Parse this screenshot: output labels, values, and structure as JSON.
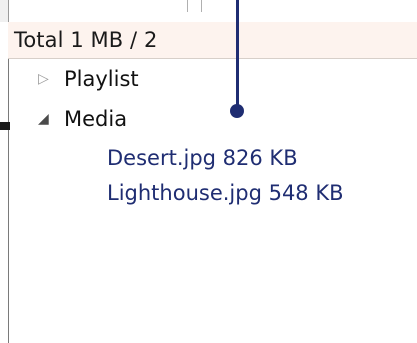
{
  "header": {
    "total_label": "Total 1 MB / 2"
  },
  "tree": {
    "items": [
      {
        "label": "Playlist",
        "state": "collapsed",
        "icon": "triangle-right-icon"
      },
      {
        "label": "Media",
        "state": "expanded",
        "icon": "triangle-down-icon",
        "children": [
          {
            "label": "Desert.jpg 826 KB"
          },
          {
            "label": "Lighthouse.jpg 548 KB"
          }
        ]
      }
    ]
  },
  "colors": {
    "header_bg": "#fdf3ee",
    "child_text": "#1f2d72",
    "pointer": "#1f2d72"
  }
}
